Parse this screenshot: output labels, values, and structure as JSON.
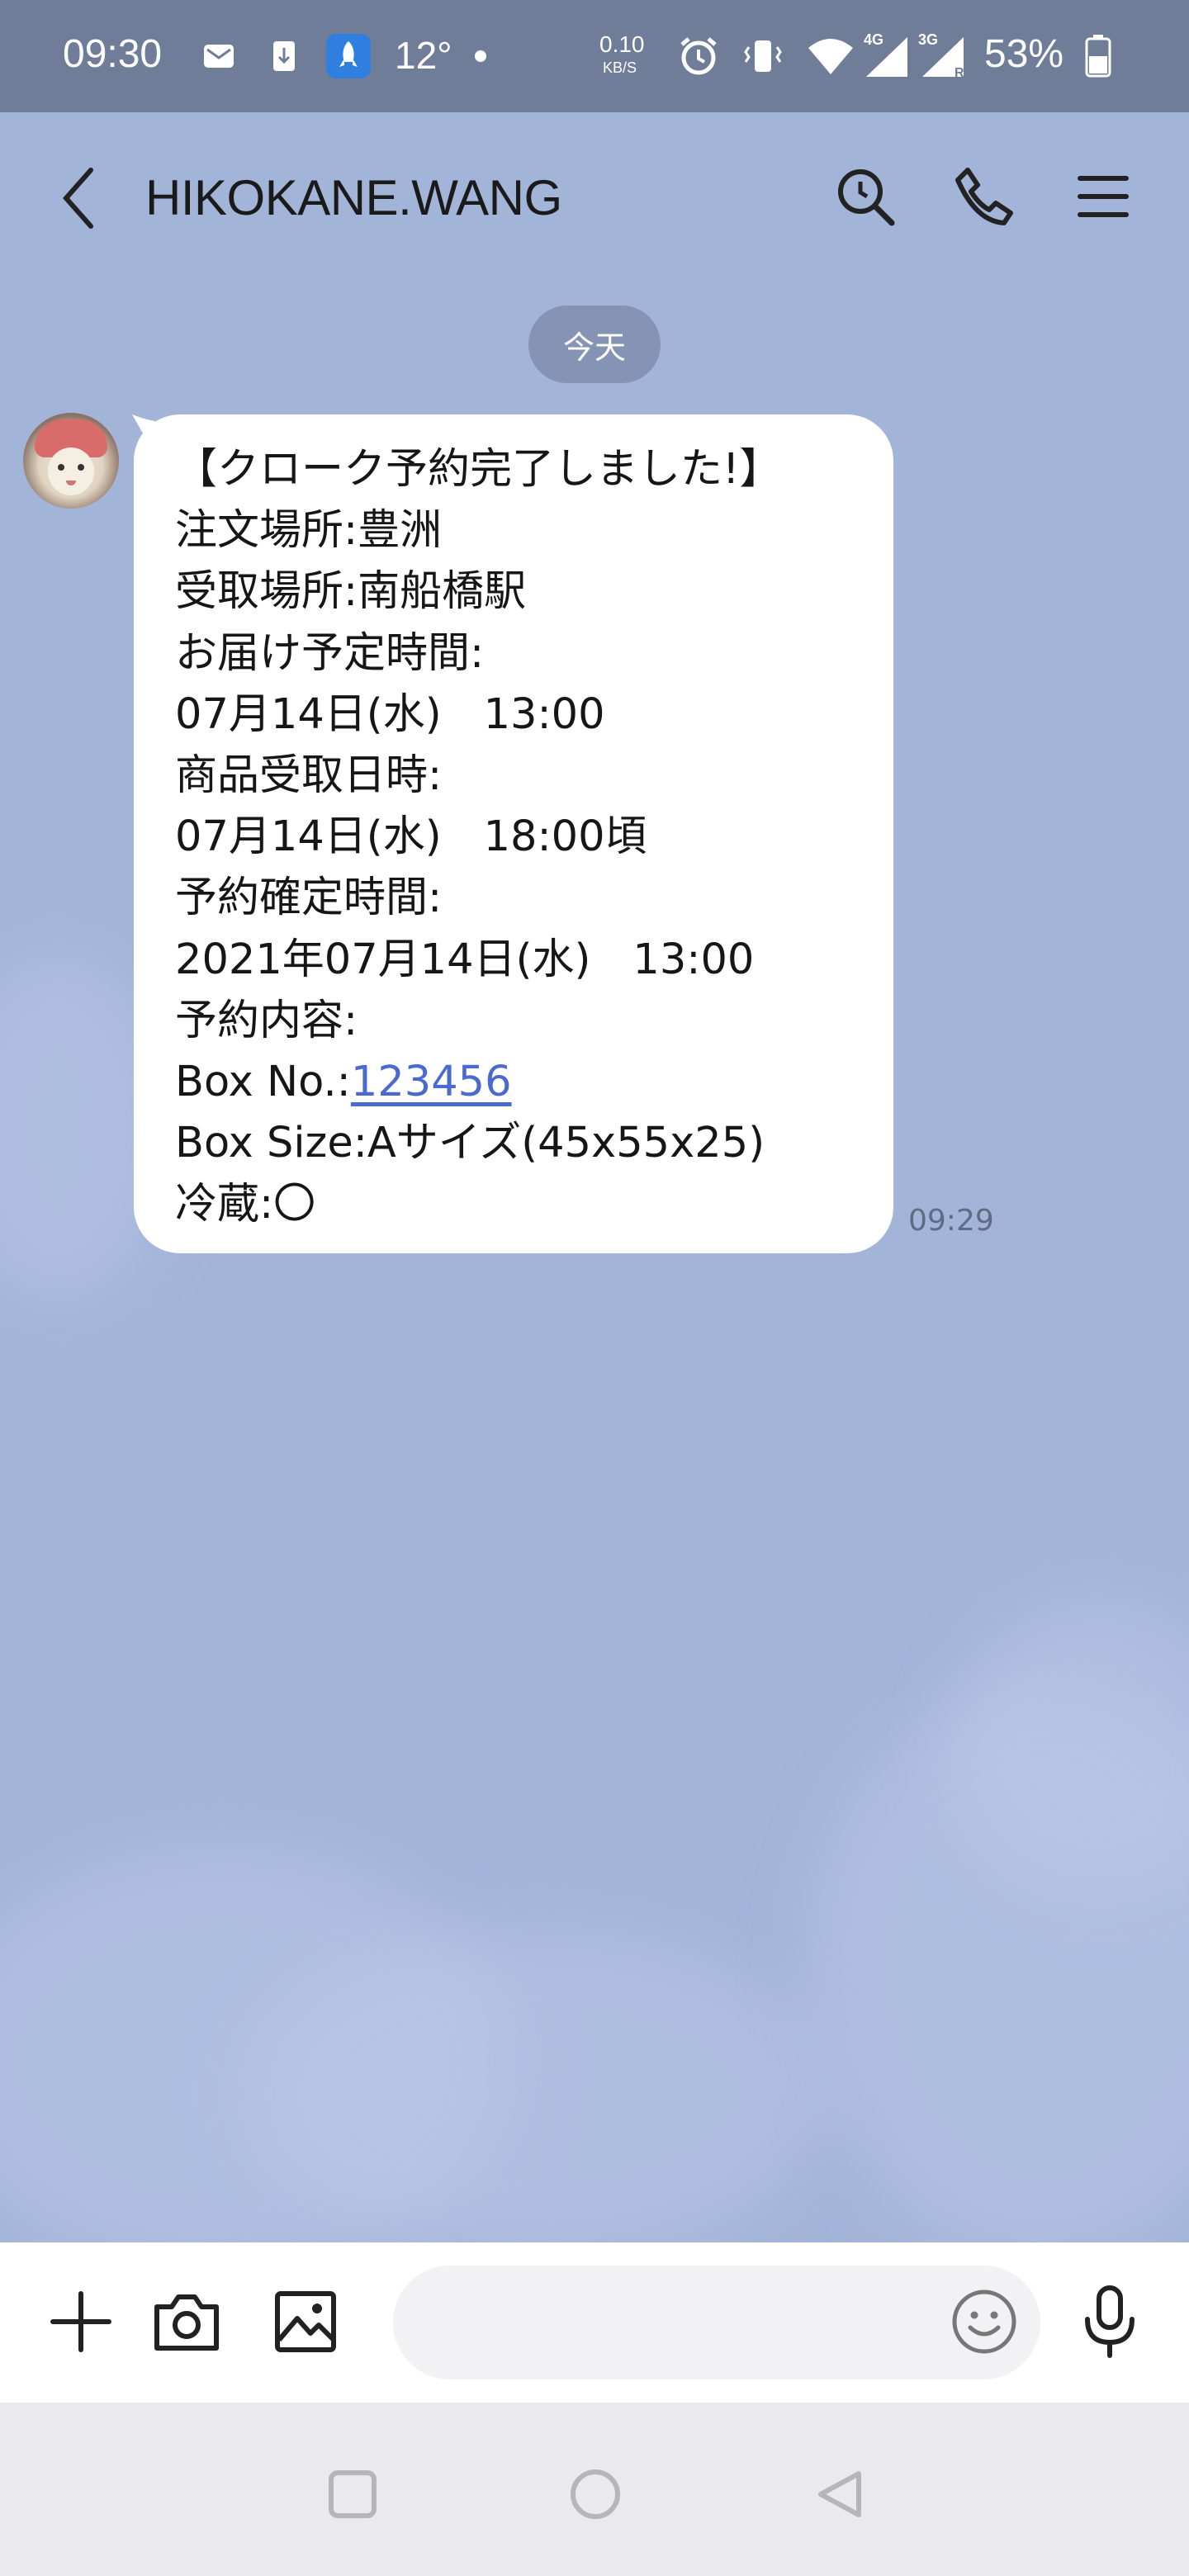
{
  "status_bar": {
    "time": "09:30",
    "temperature": "12°",
    "net_speed_value": "0.10",
    "net_speed_unit": "KB/S",
    "signal_4g": "4G",
    "signal_3g": "3G",
    "signal_r": "R",
    "battery": "53%"
  },
  "header": {
    "title": "HIKOKANE.WANG"
  },
  "chat": {
    "date_divider": "今天",
    "messages": [
      {
        "time": "09:29",
        "lines": [
          "【クローク予約完了しました!】",
          "注文場所:豊洲",
          "受取場所:南船橋駅",
          "お届け予定時間:",
          "07月14日(水)　13:00",
          "商品受取日時:",
          "07月14日(水)　18:00頃",
          "予約確定時間:",
          "2021年07月14日(水)　13:00",
          "予約内容:",
          "Box No.:",
          "Box Size:Aサイズ(45x55x25)",
          "冷蔵:〇"
        ],
        "box_no_link": "123456"
      }
    ]
  },
  "input_bar": {
    "placeholder": ""
  },
  "colors": {
    "status_bar": "#6f7d99",
    "chat_background": "#a3b4d9",
    "bubble": "#ffffff",
    "link": "#4a6ad0",
    "date_pill": "#8594b4"
  },
  "icons": [
    "back-arrow-icon",
    "search-icon",
    "phone-icon",
    "menu-icon",
    "plus-icon",
    "camera-icon",
    "image-icon",
    "emoji-icon",
    "microphone-icon"
  ]
}
